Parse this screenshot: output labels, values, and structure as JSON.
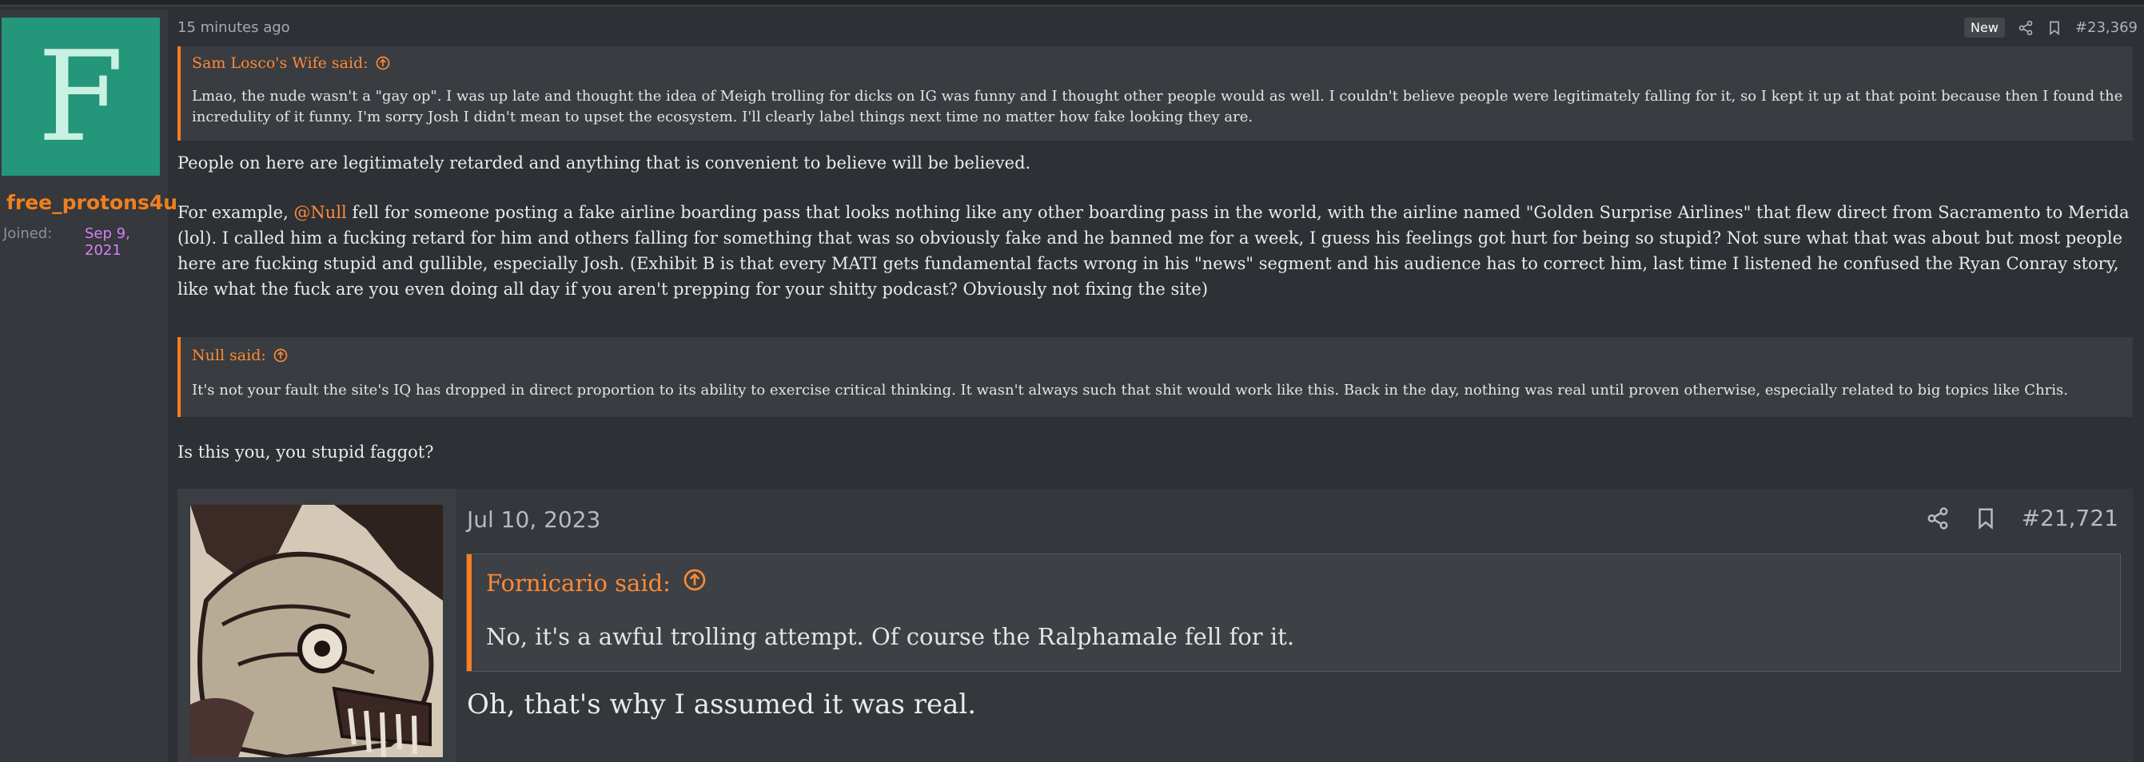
{
  "user": {
    "avatar_letter": "F",
    "username": "free_protons4u",
    "joined_label": "Joined:",
    "joined_date": "Sep 9, 2021"
  },
  "post": {
    "time_ago": "15 minutes ago",
    "new_badge": "New",
    "post_number": "#23,369",
    "quote1": {
      "author": "Sam Losco's Wife said:",
      "text": "Lmao, the nude wasn't a \"gay op\". I was up late and thought the idea of Meigh trolling for dicks on IG was funny and I thought other people would as well. I couldn't believe people were legitimately falling for it, so I kept it up at that point because then I found the incredulity of it funny. I'm sorry Josh I didn't mean to upset the ecosystem. I'll clearly label things next time no matter how fake looking they are."
    },
    "paragraph1": "People on here are legitimately retarded and anything that is convenient to believe will be believed.",
    "paragraph2_start": "For example, ",
    "mention": "@Null",
    "paragraph2_rest": " fell for someone posting a fake airline boarding pass that looks nothing like any other boarding pass in the world, with the airline named \"Golden Surprise Airlines\" that flew direct from Sacramento to Merida (lol). I called him a fucking retard for him and others falling for something that was so obviously fake and he banned me for a week, I guess his feelings got hurt for being so stupid? Not sure what that was about but most people here are fucking stupid and gullible, especially Josh. (Exhibit B is that every MATI gets fundamental facts wrong in his \"news\" segment and his audience has to correct him, last time I listened he confused the Ryan Conray story, like what the fuck are you even doing all day if you aren't prepping for your shitty podcast? Obviously not fixing the site)",
    "quote2": {
      "author": "Null said:",
      "text": "It's not your fault the site's IQ has dropped in direct proportion to its ability to exercise critical thinking. It wasn't always such that shit would work like this. Back in the day, nothing was real until proven otherwise, especially related to big topics like Chris."
    },
    "paragraph3": "Is this you, you stupid faggot?"
  },
  "embedded": {
    "date": "Jul 10, 2023",
    "post_number": "#21,721",
    "quote_author": "Fornicario said:",
    "quote_text": "No, it's a awful trolling attempt. Of course the Ralphamale fell for it.",
    "reply": "Oh, that's why I assumed it was real."
  },
  "colors": {
    "accent": "#ff7d1e",
    "avatar_bg": "#24967a",
    "joined_date": "#d880f5",
    "background": "#2d3034"
  },
  "icons": [
    "share-icon",
    "bookmark-icon",
    "arrow-up-circle-icon"
  ]
}
